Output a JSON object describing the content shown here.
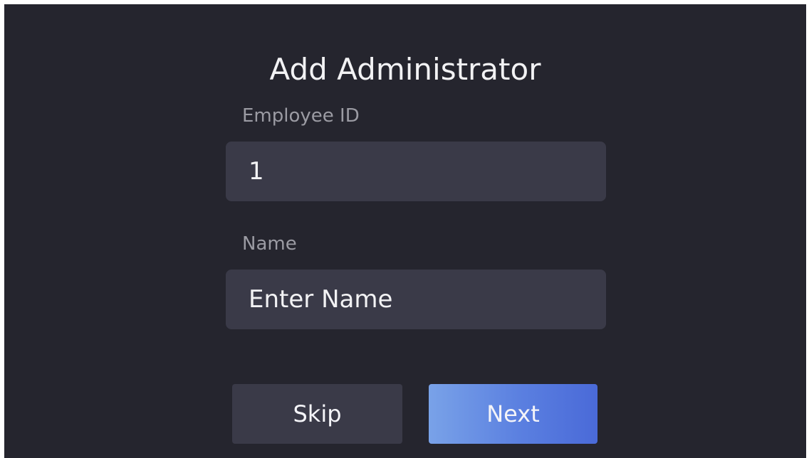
{
  "dialog": {
    "title": "Add Administrator"
  },
  "fields": {
    "employee_id": {
      "label": "Employee ID",
      "value": "1"
    },
    "name": {
      "label": "Name",
      "placeholder": "Enter Name"
    }
  },
  "buttons": {
    "skip_label": "Skip",
    "next_label": "Next"
  },
  "colors": {
    "background": "#25252e",
    "field_background": "#3a3a48",
    "accent_start": "#79a2e8",
    "accent_end": "#4a6ad8"
  }
}
